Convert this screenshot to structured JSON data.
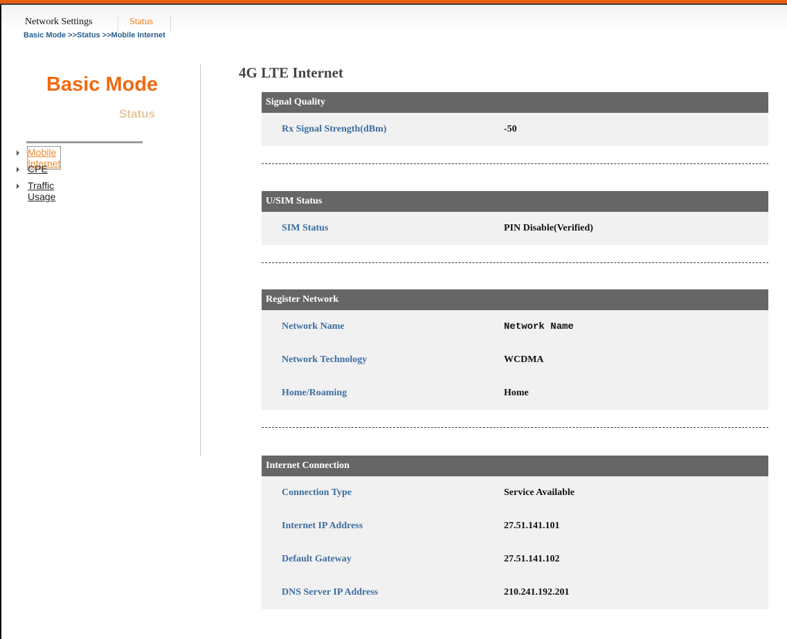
{
  "topnav": {
    "network_settings": "Network Settings",
    "status": "Status"
  },
  "breadcrumb": "Basic Mode >>Status >>Mobile Internet",
  "sidebar": {
    "title": "Basic Mode",
    "subtitle": "Status",
    "items": [
      {
        "label": "Mobile Internet",
        "active": true
      },
      {
        "label": "CPE",
        "active": false
      },
      {
        "label": "Traffic Usage",
        "active": false
      }
    ]
  },
  "main": {
    "title": "4G LTE Internet",
    "sections": [
      {
        "header": "Signal Quality",
        "rows": [
          {
            "key": "Rx Signal Strength(dBm)",
            "value": "-50"
          }
        ]
      },
      {
        "header": "U/SIM Status",
        "rows": [
          {
            "key": "SIM Status",
            "value": "PIN Disable(Verified)"
          }
        ]
      },
      {
        "header": "Register Network",
        "rows": [
          {
            "key": "Network Name",
            "value": "Network Name"
          },
          {
            "key": "Network Technology",
            "value": "WCDMA"
          },
          {
            "key": "Home/Roaming",
            "value": "Home"
          }
        ]
      },
      {
        "header": "Internet Connection",
        "rows": [
          {
            "key": "Connection Type",
            "value": "Service Available"
          },
          {
            "key": "Internet IP Address",
            "value": "27.51.141.101"
          },
          {
            "key": "Default Gateway",
            "value": "27.51.141.102"
          },
          {
            "key": "DNS Server IP Address",
            "value": "210.241.192.201"
          }
        ]
      }
    ]
  },
  "colors": {
    "accent": "#f06a12",
    "section_header": "#666666",
    "key_text": "#3c6ea0"
  }
}
